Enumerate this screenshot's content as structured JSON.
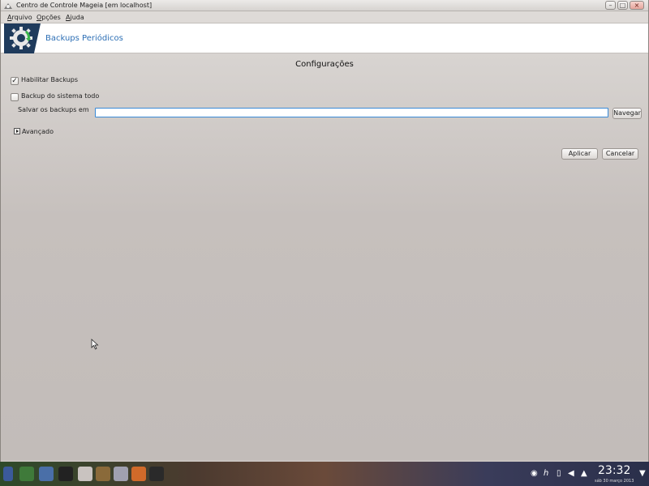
{
  "window": {
    "title": "Centro de Controle Mageia  [em localhost]",
    "controls": {
      "minimize": "–",
      "maximize": "□",
      "close": "×"
    }
  },
  "menubar": {
    "items": [
      {
        "label_first": "A",
        "label_rest": "rquivo"
      },
      {
        "label_first": "O",
        "label_rest": "pções"
      },
      {
        "label_first": "A",
        "label_rest": "juda"
      }
    ]
  },
  "header": {
    "title": "Backups Periódicos",
    "logo_icon": "gear-logo-icon"
  },
  "content": {
    "section_title": "Configurações",
    "enable_backups": {
      "label": "Habilitar Backups",
      "checked": true,
      "mark": "✓"
    },
    "whole_system": {
      "label": "Backup do sistema todo",
      "checked": false
    },
    "save_path": {
      "label": "Salvar os backups em",
      "value": ""
    },
    "browse_label": "Navegar",
    "advanced_label": "Avançado",
    "apply_label": "Aplicar",
    "cancel_label": "Cancelar"
  },
  "taskbar": {
    "clock_time": "23:32",
    "clock_date": "sáb 30 março 2013"
  },
  "colors": {
    "header_title": "#2d6fb5",
    "logo_bg": "#1f3b5c",
    "input_border": "#3a8ad6"
  }
}
